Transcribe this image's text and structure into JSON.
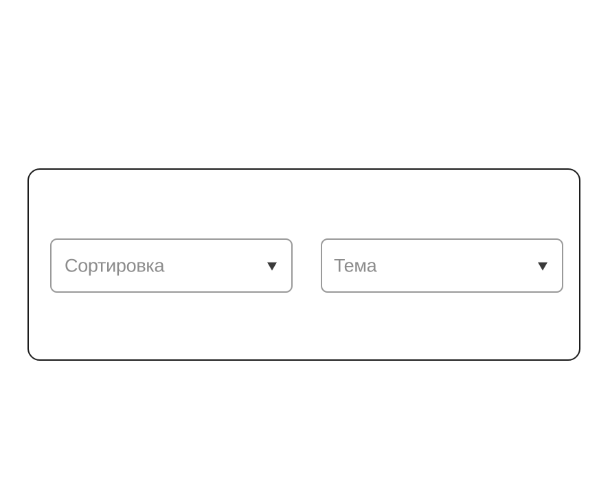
{
  "filters": {
    "sort": {
      "placeholder": "Сортировка",
      "icon": "chevron-down-icon"
    },
    "topic": {
      "placeholder": "Тема",
      "icon": "chevron-down-icon"
    }
  },
  "colors": {
    "panel_border": "#1c1c1c",
    "select_border": "#9a9a9a",
    "placeholder_text": "#8c8c8c",
    "caret": "#3a3a3a"
  }
}
